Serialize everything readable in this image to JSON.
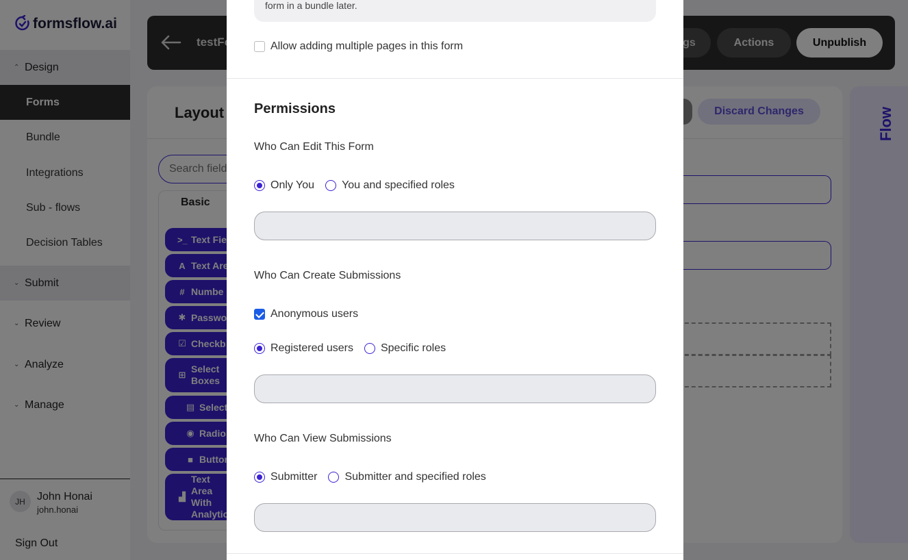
{
  "app": {
    "logo_text": "formsflow.ai",
    "colors": {
      "accent": "#3a22d4",
      "dark": "#2c2c2c",
      "flow_panel": "#e6e4fb",
      "checkbox": "#1a5ce6"
    }
  },
  "sidebar": {
    "sections": [
      {
        "label": "Design",
        "expanded": true
      },
      {
        "label": "Submit",
        "expanded": false
      },
      {
        "label": "Review",
        "expanded": false
      },
      {
        "label": "Analyze",
        "expanded": false
      },
      {
        "label": "Manage",
        "expanded": false
      }
    ],
    "design_items": [
      {
        "label": "Forms",
        "active": true
      },
      {
        "label": "Bundle",
        "active": false
      },
      {
        "label": "Integrations",
        "active": false
      },
      {
        "label": "Sub - flows",
        "active": false
      },
      {
        "label": "Decision Tables",
        "active": false
      }
    ],
    "user": {
      "initials": "JH",
      "name": "John Honai",
      "handle": "john.honai"
    },
    "sign_out": "Sign Out"
  },
  "topbar": {
    "form_title": "testFo",
    "settings_label": "gs",
    "actions_label": "Actions",
    "unpublish_label": "Unpublish"
  },
  "builder": {
    "title": "Layout",
    "discard_label": "Discard Changes",
    "search_placeholder": "Search field",
    "palette_tab": "Basic",
    "components": [
      {
        "icon": "text-field-icon",
        "glyph": ">_",
        "label": "Text Fie"
      },
      {
        "icon": "text-area-icon",
        "glyph": "A",
        "label": "Text Are"
      },
      {
        "icon": "number-icon",
        "glyph": "#",
        "label": "Numbe"
      },
      {
        "icon": "password-icon",
        "glyph": "✱",
        "label": "Passwo"
      },
      {
        "icon": "checkbox-icon",
        "glyph": "☑",
        "label": "Checkb"
      },
      {
        "icon": "select-boxes-icon",
        "glyph": "⊞",
        "label": "Select Boxes"
      },
      {
        "icon": "select-icon",
        "glyph": "▤",
        "label": "Select"
      },
      {
        "icon": "radio-icon",
        "glyph": "◉",
        "label": "Radio"
      },
      {
        "icon": "button-icon",
        "glyph": "■",
        "label": "Button"
      },
      {
        "icon": "analytics-icon",
        "glyph": "▟",
        "label": "Text Area With Analytic"
      }
    ]
  },
  "flow_panel": {
    "label": "Flow"
  },
  "modal": {
    "note_text": "form in a bundle later.",
    "multi_page_label": "Allow adding multiple pages in this form",
    "multi_page_checked": false,
    "permissions_heading": "Permissions",
    "edit": {
      "question": "Who Can Edit This Form",
      "options": [
        {
          "label": "Only You",
          "selected": true
        },
        {
          "label": "You and specified roles",
          "selected": false
        }
      ]
    },
    "create": {
      "question": "Who Can Create Submissions",
      "anonymous_label": "Anonymous users",
      "anonymous_checked": true,
      "options": [
        {
          "label": "Registered users",
          "selected": true
        },
        {
          "label": "Specific roles",
          "selected": false
        }
      ]
    },
    "view": {
      "question": "Who Can View Submissions",
      "options": [
        {
          "label": "Submitter",
          "selected": true
        },
        {
          "label": "Submitter and specified roles",
          "selected": false
        }
      ]
    }
  }
}
